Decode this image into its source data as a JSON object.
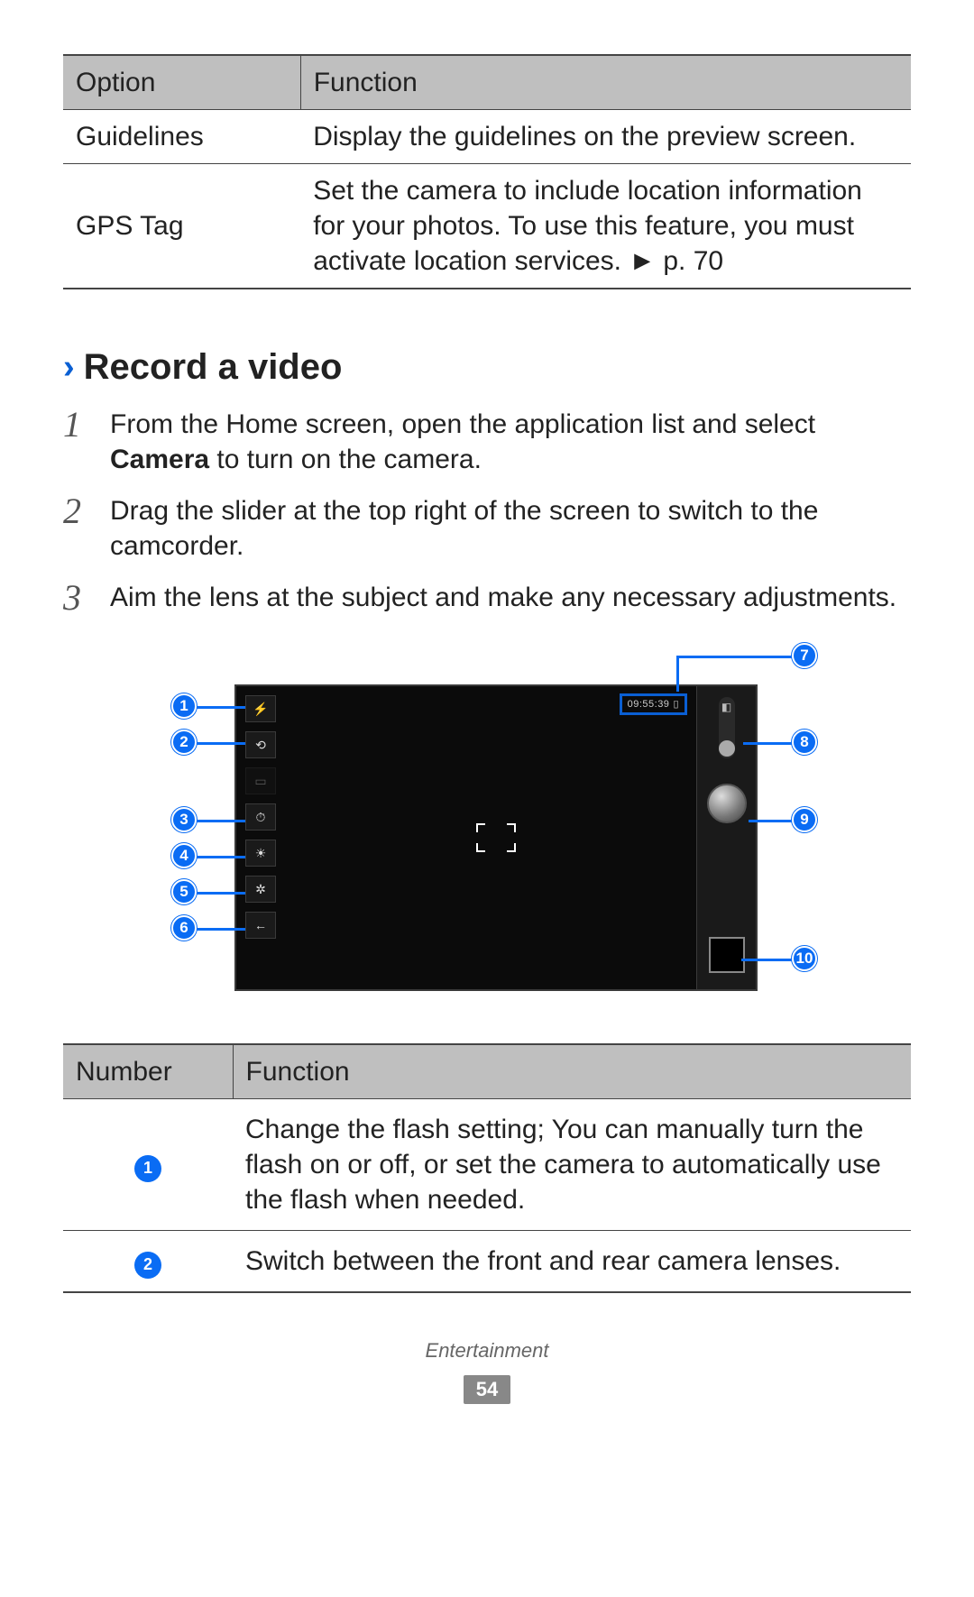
{
  "options_table": {
    "headers": [
      "Option",
      "Function"
    ],
    "rows": [
      {
        "option": "Guidelines",
        "function": "Display the guidelines on the preview screen."
      },
      {
        "option": "GPS Tag",
        "function": "Set the camera to include location information for your photos. To use this feature, you must activate location services. ► p. 70"
      }
    ]
  },
  "section": {
    "title": "Record a video",
    "steps": [
      {
        "num": "1",
        "pre": "From the Home screen, open the application list and select ",
        "bold": "Camera",
        "post": " to turn on the camera."
      },
      {
        "num": "2",
        "pre": "Drag the slider at the top right of the screen to switch to the camcorder.",
        "bold": "",
        "post": ""
      },
      {
        "num": "3",
        "pre": "Aim the lens at the subject and make any necessary adjustments.",
        "bold": "",
        "post": ""
      }
    ]
  },
  "diagram": {
    "time": "09:55:39",
    "callouts": [
      "1",
      "2",
      "3",
      "4",
      "5",
      "6",
      "7",
      "8",
      "9",
      "10"
    ]
  },
  "num_table": {
    "headers": [
      "Number",
      "Function"
    ],
    "rows": [
      {
        "num": "1",
        "function": "Change the flash setting; You can manually turn the flash on or off, or set the camera to automatically use the flash when needed."
      },
      {
        "num": "2",
        "function": "Switch between the front and rear camera lenses."
      }
    ]
  },
  "footer": {
    "section": "Entertainment",
    "page": "54"
  }
}
